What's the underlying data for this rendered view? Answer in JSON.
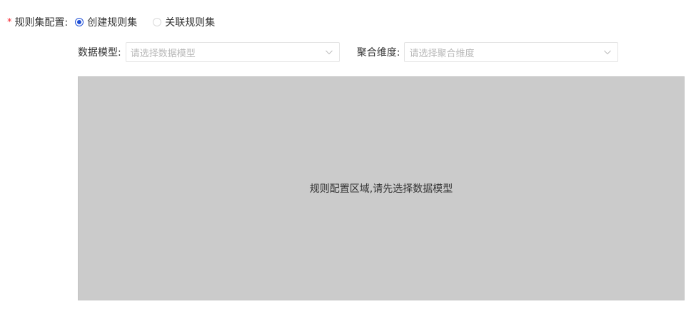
{
  "ruleset": {
    "required_mark": "*",
    "label": "规则集配置:",
    "options": [
      {
        "label": "创建规则集",
        "checked": true
      },
      {
        "label": "关联规则集",
        "checked": false
      }
    ]
  },
  "selects": {
    "data_model": {
      "label": "数据模型:",
      "placeholder": "请选择数据模型"
    },
    "aggregation_dimension": {
      "label": "聚合维度:",
      "placeholder": "请选择聚合维度"
    }
  },
  "config_area": {
    "hint": "规则配置区域,请先选择数据模型"
  },
  "colors": {
    "accent": "#1f4fd6",
    "required": "#f5222d",
    "placeholder": "#b8b8b8",
    "config_background": "#cbcbcb"
  },
  "icons": {
    "select_arrow": "chevron-down-icon"
  }
}
